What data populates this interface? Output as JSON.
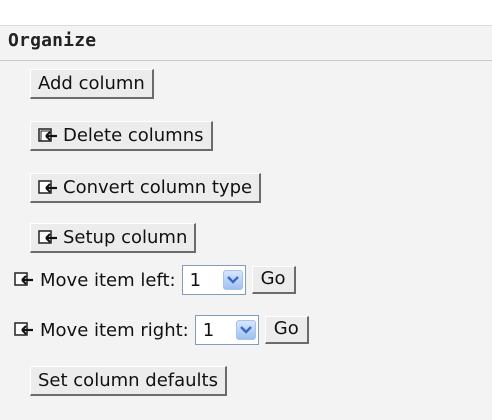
{
  "panel": {
    "title": "Organize"
  },
  "buttons": {
    "add_column": "Add column",
    "delete_columns": "Delete columns",
    "convert_column_type": "Convert column type",
    "setup_column": "Setup column",
    "set_column_defaults": "Set column defaults"
  },
  "move_left": {
    "label": "Move item left:",
    "selected": "1",
    "go": "Go"
  },
  "move_right": {
    "label": "Move item right:",
    "selected": "1",
    "go": "Go"
  },
  "icons": {
    "delete_columns": "move-arrow-icon",
    "convert_column_type": "move-arrow-icon",
    "setup_column": "move-arrow-icon",
    "move_left": "move-arrow-icon",
    "move_right": "move-arrow-icon",
    "select_arrow": "chevron-down-icon"
  },
  "colors": {
    "panel_bg": "#f3f3f3",
    "button_bg": "#ececec",
    "select_arrow": "#3b68c8"
  }
}
